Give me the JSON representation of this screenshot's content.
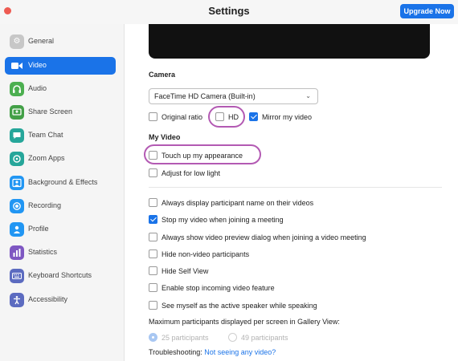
{
  "window": {
    "title": "Settings",
    "upgrade_button": "Upgrade Now",
    "accent": "#1a73e8",
    "annotation_color": "#b35ab3"
  },
  "sidebar": {
    "items": [
      {
        "label": "General",
        "icon": "gear-icon",
        "color": "#c7c7c7",
        "active": false
      },
      {
        "label": "Video",
        "icon": "video-camera-icon",
        "color": "#ffffff",
        "active": true
      },
      {
        "label": "Audio",
        "icon": "headphones-icon",
        "color": "#4caf50",
        "active": false
      },
      {
        "label": "Share Screen",
        "icon": "share-screen-icon",
        "color": "#43a047",
        "active": false
      },
      {
        "label": "Team Chat",
        "icon": "chat-bubble-icon",
        "color": "#26a69a",
        "active": false
      },
      {
        "label": "Zoom Apps",
        "icon": "apps-icon",
        "color": "#26a69a",
        "active": false
      },
      {
        "label": "Background & Effects",
        "icon": "background-person-icon",
        "color": "#2196f3",
        "active": false
      },
      {
        "label": "Recording",
        "icon": "record-icon",
        "color": "#2196f3",
        "active": false
      },
      {
        "label": "Profile",
        "icon": "person-icon",
        "color": "#2196f3",
        "active": false
      },
      {
        "label": "Statistics",
        "icon": "statistics-icon",
        "color": "#7e57c2",
        "active": false
      },
      {
        "label": "Keyboard Shortcuts",
        "icon": "keyboard-icon",
        "color": "#5c6bc0",
        "active": false
      },
      {
        "label": "Accessibility",
        "icon": "accessibility-icon",
        "color": "#5c6bc0",
        "active": false
      }
    ]
  },
  "camera": {
    "heading": "Camera",
    "selected": "FaceTime HD Camera (Built-in)",
    "original_ratio": {
      "label": "Original ratio",
      "checked": false
    },
    "hd": {
      "label": "HD",
      "checked": false
    },
    "mirror": {
      "label": "Mirror my video",
      "checked": true
    }
  },
  "my_video": {
    "heading": "My Video",
    "touch_up": {
      "label": "Touch up my appearance",
      "checked": false
    },
    "low_light": {
      "label": "Adjust for low light",
      "checked": false
    }
  },
  "options": [
    {
      "label": "Always display participant name on their videos",
      "checked": false
    },
    {
      "label": "Stop my video when joining a meeting",
      "checked": true
    },
    {
      "label": "Always show video preview dialog when joining a video meeting",
      "checked": false
    },
    {
      "label": "Hide non-video participants",
      "checked": false
    },
    {
      "label": "Hide Self View",
      "checked": false
    },
    {
      "label": "Enable stop incoming video feature",
      "checked": false
    },
    {
      "label": "See myself as the active speaker while speaking",
      "checked": false
    }
  ],
  "gallery": {
    "label": "Maximum participants displayed per screen in Gallery View:",
    "option_25": {
      "label": "25 participants",
      "selected": true
    },
    "option_49": {
      "label": "49 participants",
      "selected": false
    }
  },
  "troubleshooting": {
    "prefix": "Troubleshooting:",
    "link": "Not seeing any video?"
  }
}
